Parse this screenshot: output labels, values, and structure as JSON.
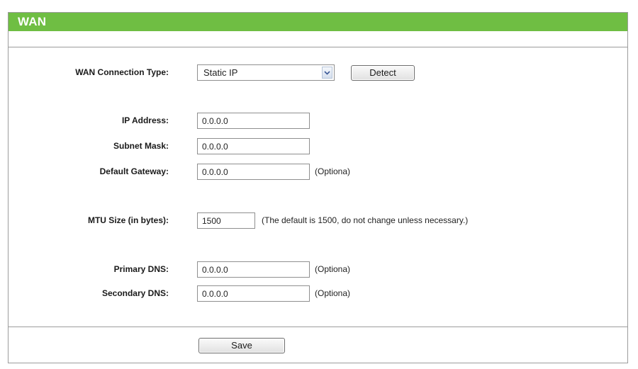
{
  "header": {
    "title": "WAN"
  },
  "wan_type": {
    "label": "WAN Connection Type:",
    "selected": "Static IP",
    "detect_label": "Detect"
  },
  "ip": {
    "ip_label": "IP Address:",
    "ip_value": "0.0.0.0",
    "mask_label": "Subnet Mask:",
    "mask_value": "0.0.0.0",
    "gateway_label": "Default Gateway:",
    "gateway_value": "0.0.0.0",
    "gateway_hint": "(Optiona)"
  },
  "mtu": {
    "label": "MTU Size (in bytes):",
    "value": "1500",
    "hint": "(The default is 1500, do not change unless necessary.)"
  },
  "dns": {
    "primary_label": "Primary DNS:",
    "primary_value": "0.0.0.0",
    "primary_hint": "(Optiona)",
    "secondary_label": "Secondary DNS:",
    "secondary_value": "0.0.0.0",
    "secondary_hint": "(Optiona)"
  },
  "footer": {
    "save_label": "Save"
  },
  "colors": {
    "header": "#6fbe43",
    "border": "#9c9c9c"
  },
  "icons": {
    "select_arrow": "chevron-down-icon"
  }
}
